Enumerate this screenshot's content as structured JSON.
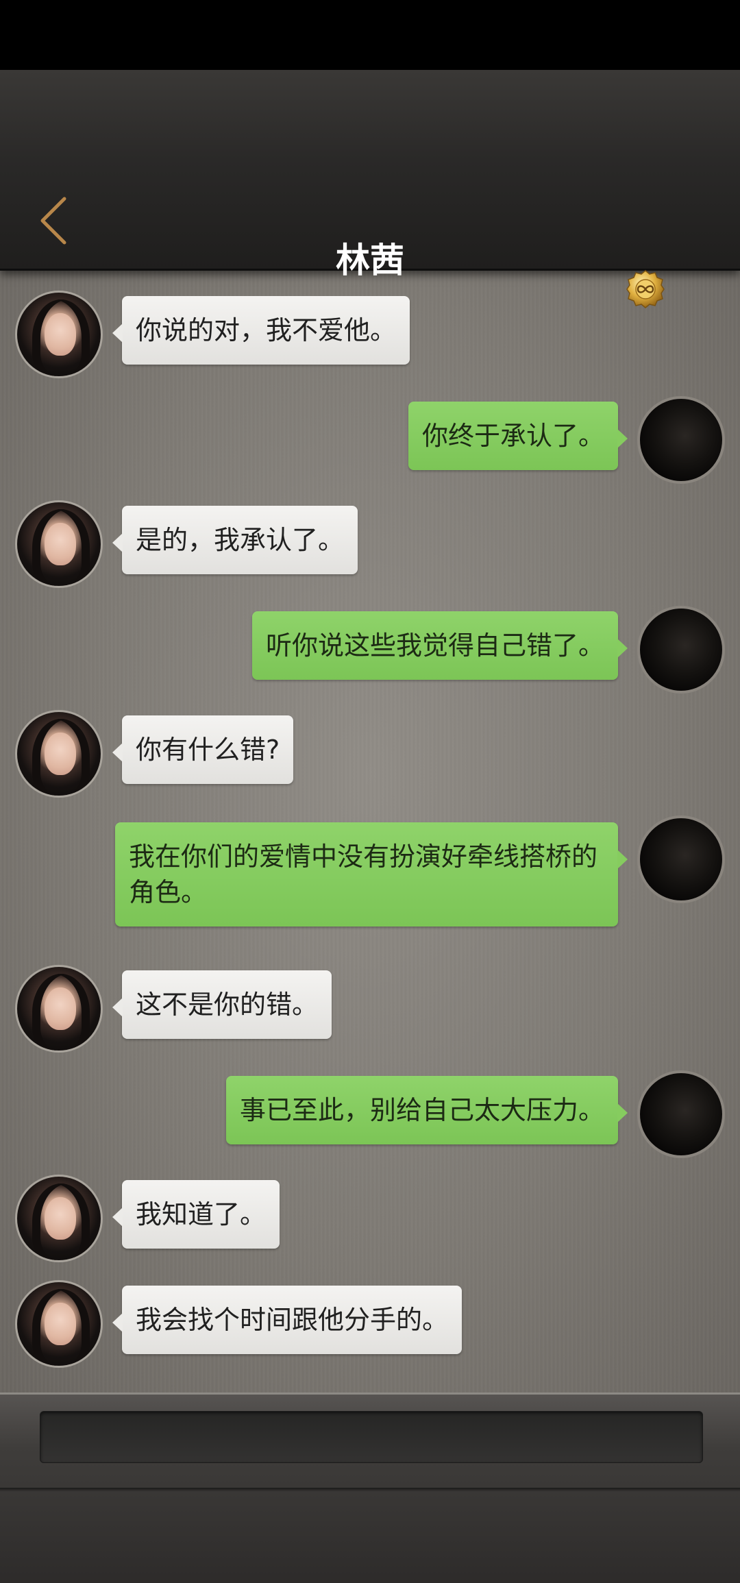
{
  "header": {
    "title": "林茜",
    "back_icon": "chevron-left-icon",
    "coin_icon": "infinity-coin-icon",
    "accent_color": "#b8874a"
  },
  "colors": {
    "sent_bubble": "#86cc5f",
    "received_bubble": "#ecebe8"
  },
  "messages": [
    {
      "side": "left",
      "text": "你说的对，我不爱他。"
    },
    {
      "side": "right",
      "text": "你终于承认了。"
    },
    {
      "side": "left",
      "text": "是的，我承认了。"
    },
    {
      "side": "right",
      "text": "听你说这些我觉得自己错了。"
    },
    {
      "side": "left",
      "text": "你有什么错?"
    },
    {
      "side": "right",
      "text": "我在你们的爱情中没有扮演好牵线搭桥的角色。"
    },
    {
      "side": "left",
      "text": "这不是你的错。"
    },
    {
      "side": "right",
      "text": "事已至此，别给自己太大压力。"
    },
    {
      "side": "left",
      "text": "我知道了。"
    },
    {
      "side": "left",
      "text": "我会找个时间跟他分手的。"
    }
  ],
  "input": {
    "value": "",
    "placeholder": ""
  }
}
